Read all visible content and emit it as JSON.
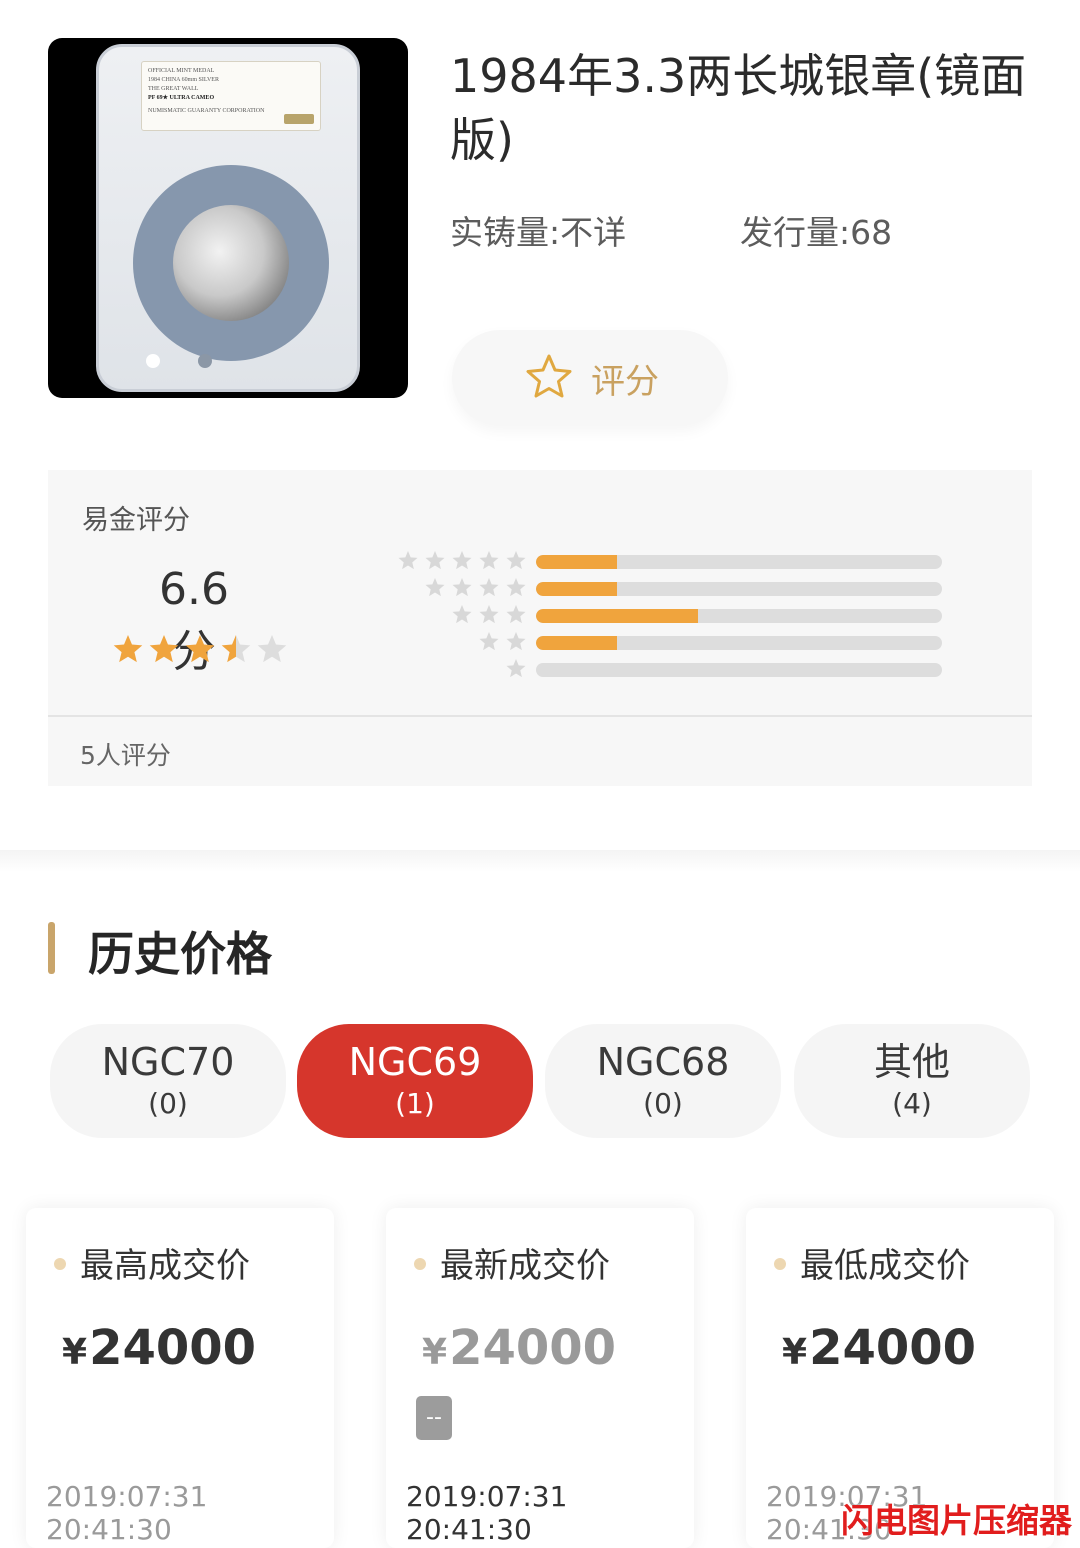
{
  "product": {
    "title": "1984年3.3两长城银章(镜面版)",
    "mintage_label": "实铸量:",
    "mintage_value": "不详",
    "issue_label": "发行量:",
    "issue_value": "68",
    "rate_button_label": "评分",
    "slab_label_lines": [
      "OFFICIAL MINT MEDAL",
      "1984 CHINA 60mm SILVER",
      "THE GREAT WALL",
      "PF 69★ ULTRA CAMEO",
      "NUMISMATIC GUARANTY CORPORATION"
    ],
    "image_slide_count": 2,
    "image_slide_active": 1
  },
  "rating": {
    "title": "易金评分",
    "score": "6.6分",
    "score_stars": 3.5,
    "distribution": [
      {
        "stars": 5,
        "fraction": 0.2
      },
      {
        "stars": 4,
        "fraction": 0.2
      },
      {
        "stars": 3,
        "fraction": 0.4
      },
      {
        "stars": 2,
        "fraction": 0.2
      },
      {
        "stars": 1,
        "fraction": 0.0
      }
    ],
    "count_text": "5人评分",
    "accent_color": "#f0a43d"
  },
  "history": {
    "title": "历史价格",
    "tabs": [
      {
        "name": "NGC70",
        "count": "(0)",
        "active": false
      },
      {
        "name": "NGC69",
        "count": "(1)",
        "active": true
      },
      {
        "name": "NGC68",
        "count": "(0)",
        "active": false
      },
      {
        "name": "其他",
        "count": "(4)",
        "active": false
      }
    ],
    "active_tab_color": "#d6362c",
    "cards": [
      {
        "label": "最高成交价",
        "currency": "¥",
        "value": "24000",
        "date": "2019:07:31 20:41:30"
      },
      {
        "label": "最新成交价",
        "currency": "¥",
        "value": "24000",
        "tag": "--",
        "date": "2019:07:31 20:41:30"
      },
      {
        "label": "最低成交价",
        "currency": "¥",
        "value": "24000",
        "date": "2019:07:31 20:41:30"
      }
    ]
  },
  "watermark": "闪电图片压缩器"
}
